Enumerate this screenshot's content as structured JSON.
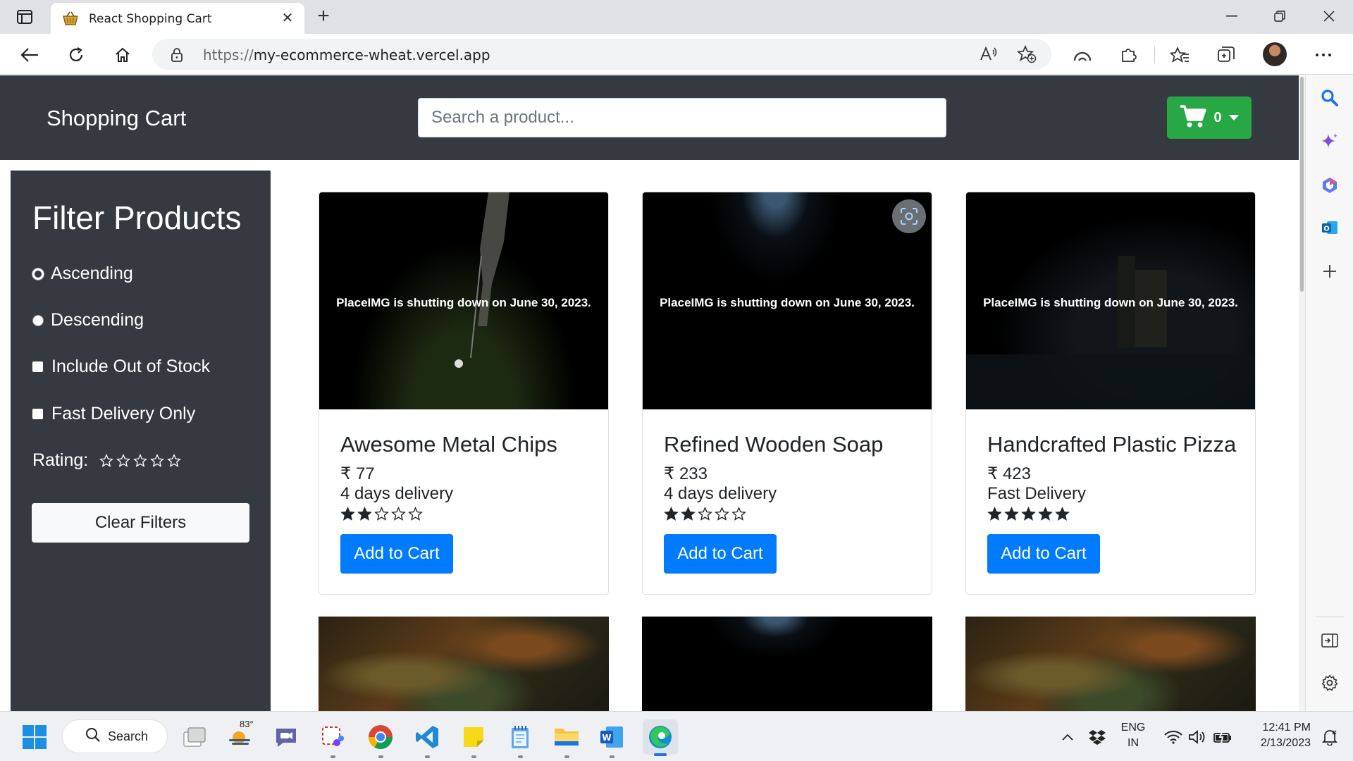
{
  "browser": {
    "tab_title": "React Shopping Cart",
    "url_scheme": "https://",
    "url_host": "my-ecommerce-wheat.vercel.app"
  },
  "header": {
    "brand": "Shopping Cart",
    "search_placeholder": "Search a product...",
    "cart_count": "0",
    "colors": {
      "header_bg": "#343a40",
      "cart_btn": "#28a745"
    }
  },
  "sidebar": {
    "title": "Filter Products",
    "options": [
      {
        "label": "Ascending",
        "type": "radio"
      },
      {
        "label": "Descending",
        "type": "radio"
      },
      {
        "label": "Include Out of Stock",
        "type": "checkbox"
      },
      {
        "label": "Fast Delivery Only",
        "type": "checkbox"
      }
    ],
    "rating_label": "Rating:",
    "rating_value": 0,
    "clear_label": "Clear Filters"
  },
  "products": [
    {
      "name": "Awesome Metal Chips",
      "price": "₹ 77",
      "delivery": "4 days delivery",
      "rating": 2,
      "image_note": "PlaceIMG is shutting down on June 30, 2023.",
      "button": "Add to Cart"
    },
    {
      "name": "Refined Wooden Soap",
      "price": "₹ 233",
      "delivery": "4 days delivery",
      "rating": 2,
      "image_note": "PlaceIMG is shutting down on June 30, 2023.",
      "button": "Add to Cart"
    },
    {
      "name": "Handcrafted Plastic Pizza",
      "price": "₹ 423",
      "delivery": "Fast Delivery",
      "rating": 5,
      "image_note": "PlaceIMG is shutting down on June 30, 2023.",
      "button": "Add to Cart"
    }
  ],
  "taskbar": {
    "search_label": "Search",
    "weather_temp": "83°",
    "lang_line1": "ENG",
    "lang_line2": "IN",
    "time": "12:41 PM",
    "date": "2/13/2023"
  },
  "colors": {
    "primary_button": "#007bff",
    "accent": "#343a40"
  }
}
